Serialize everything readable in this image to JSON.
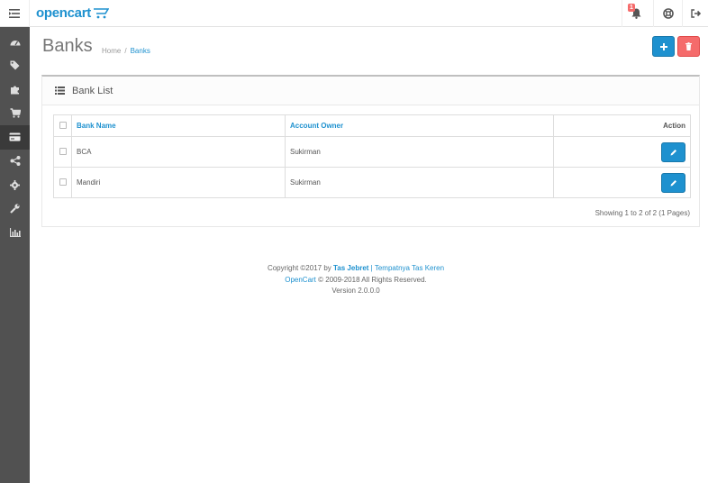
{
  "header": {
    "logo_text": "opencart",
    "notification_count": "1"
  },
  "sidebar": {
    "items": [
      {
        "icon": "dashboard-icon"
      },
      {
        "icon": "tags-icon"
      },
      {
        "icon": "puzzle-icon"
      },
      {
        "icon": "cart-icon"
      },
      {
        "icon": "credit-card-icon"
      },
      {
        "icon": "share-icon"
      },
      {
        "icon": "gear-icon"
      },
      {
        "icon": "wrench-icon"
      },
      {
        "icon": "bar-chart-icon"
      }
    ],
    "active_index": 4
  },
  "page": {
    "title": "Banks",
    "breadcrumb": {
      "home": "Home",
      "separator": "/",
      "current": "Banks"
    }
  },
  "panel": {
    "title": "Bank List",
    "columns": {
      "name": "Bank Name",
      "owner": "Account Owner",
      "action": "Action"
    },
    "rows": [
      {
        "name": "BCA",
        "owner": "Sukirman"
      },
      {
        "name": "Mandiri",
        "owner": "Sukirman"
      }
    ],
    "pagination": "Showing 1 to 2 of 2 (1 Pages)"
  },
  "footer": {
    "copyright_prefix": "Copyright ©2017 by",
    "author": "Tas Jebret",
    "divider": "|",
    "tagline": "Tempatnya Tas Keren",
    "opencart_link": "OpenCart",
    "rights": "© 2009-2018 All Rights Reserved.",
    "version": "Version 2.0.0.0"
  },
  "colors": {
    "accent": "#1e91cf",
    "danger": "#f56b6b",
    "sidebar": "#515151"
  }
}
